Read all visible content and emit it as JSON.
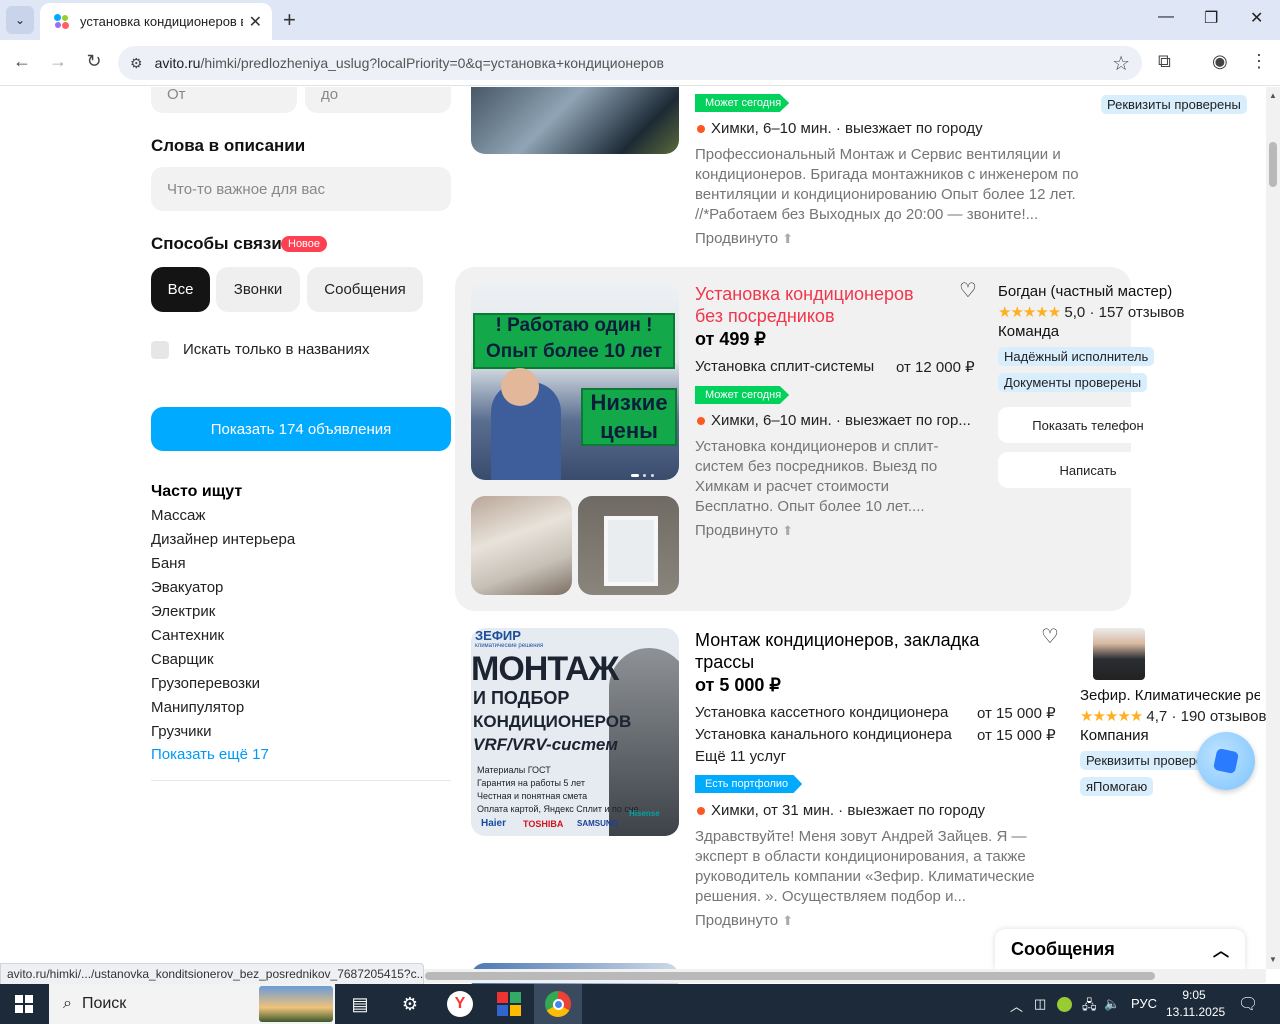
{
  "browser": {
    "tab_title": "установка кондиционеров в Химках",
    "url_domain": "avito.ru",
    "url_path": "/himki/predlozheniya_uslug?localPriority=0&q=установка+кондиционеров",
    "status_url": "avito.ru/himki/.../ustanovka_konditsionerov_bez_posrednikov_7687205415?c..."
  },
  "filters": {
    "from_placeholder": "От",
    "to_placeholder": "до",
    "desc_words_heading": "Слова в описании",
    "desc_words_placeholder": "Что-то важное для вас",
    "contact_heading": "Способы связи",
    "new_badge": "Новое",
    "contact_options": [
      "Все",
      "Звонки",
      "Сообщения"
    ],
    "titles_only_label": "Искать только в названиях",
    "show_button": "Показать 174 объявления"
  },
  "often": {
    "heading": "Часто ищут",
    "items": [
      "Массаж",
      "Дизайнер интерьера",
      "Баня",
      "Эвакуатор",
      "Электрик",
      "Сантехник",
      "Сварщик",
      "Грузоперевозки",
      "Манипулятор",
      "Грузчики"
    ],
    "more": "Показать ещё 17"
  },
  "listing1": {
    "tag": "Может сегодня",
    "location": "Химки, 6–10 мин. · выезжает по городу",
    "description": "Профессиональный Монтаж и Сервис вентиляции и кондиционеров. Бригада монтажников с инженером по вентиляции и кондиционированию Опыт более 12 лет. //*Работаем без Выходных до 20:00 — звоните!...",
    "promoted": "Продвинуто",
    "seller_chip": "Реквизиты проверены"
  },
  "listing2": {
    "title": "Установка кондиционеров без посредников",
    "price": "от 499 ₽",
    "service_name": "Установка сплит-системы",
    "service_price": "от 12 000 ₽",
    "tag": "Может сегодня",
    "location": "Химки, 6–10 мин. · выезжает по гор...",
    "description": "Установка кондиционеров и сплит-систем без посредников. Выезд по Химкам и расчет стоимости Бесплатно. Опыт более 10 лет....",
    "promoted": "Продвинуто",
    "img_text1": "! Работаю один !",
    "img_text2": "Опыт более 10 лет",
    "img_text3": "Низкие",
    "img_text4": "цены",
    "seller": "Богдан (частный мастер)",
    "rating": "5,0",
    "reviews": "157 отзывов",
    "seller_type": "Команда",
    "chips": [
      "Надёжный исполнитель",
      "Документы проверены"
    ],
    "show_phone": "Показать телефон",
    "write": "Написать",
    "stars": "★★★★★"
  },
  "listing3": {
    "title": "Монтаж кондиционеров, закладка трассы",
    "price": "от 5 000 ₽",
    "services": [
      {
        "name": "Установка кассетного кондиционера",
        "price": "от 15 000 ₽"
      },
      {
        "name": "Установка канального кондиционера",
        "price": "от 15 000 ₽"
      }
    ],
    "more_services": "Ещё 11 услуг",
    "tag": "Есть портфолио",
    "location": "Химки, от 31 мин. · выезжает по городу",
    "description": "Здравствуйте! Меня зовут Андрей Зайцев. Я — эксперт в области кондиционирования, а также руководитель компании «Зефир. Климатические решения. ». Осуществляем подбор и...",
    "promoted": "Продвинуто",
    "seller": "Зефир. Климатические решения",
    "rating": "4,7",
    "reviews": "190 отзывов",
    "seller_type": "Компания",
    "chips": [
      "Реквизиты проверены",
      "яПомогаю"
    ],
    "stars": "★★★★★",
    "img": {
      "brand": "ЗЕФИР",
      "brand_sub": "климатические решения",
      "line1": "МОНТАЖ",
      "line2": "И ПОДБОР",
      "line3": "КОНДИЦИОНЕРОВ",
      "line4": "VRF/VRV-систем",
      "bullets": [
        "Материалы ГОСТ",
        "Гарантия на работы 5 лет",
        "Честная и понятная смета",
        "Оплата картой, Яндекс Сплит и по сче"
      ],
      "logos": [
        "Haier",
        "TOSHIBA",
        "SAMSUNG",
        "Hisense"
      ]
    }
  },
  "messages_label": "Сообщения",
  "taskbar": {
    "search": "Поиск",
    "lang": "РУС",
    "time": "9:05",
    "date": "13.11.2025"
  },
  "colors": {
    "accent": "#00aaff",
    "title_red": "#f0364c",
    "green_tag": "#02d15c"
  }
}
